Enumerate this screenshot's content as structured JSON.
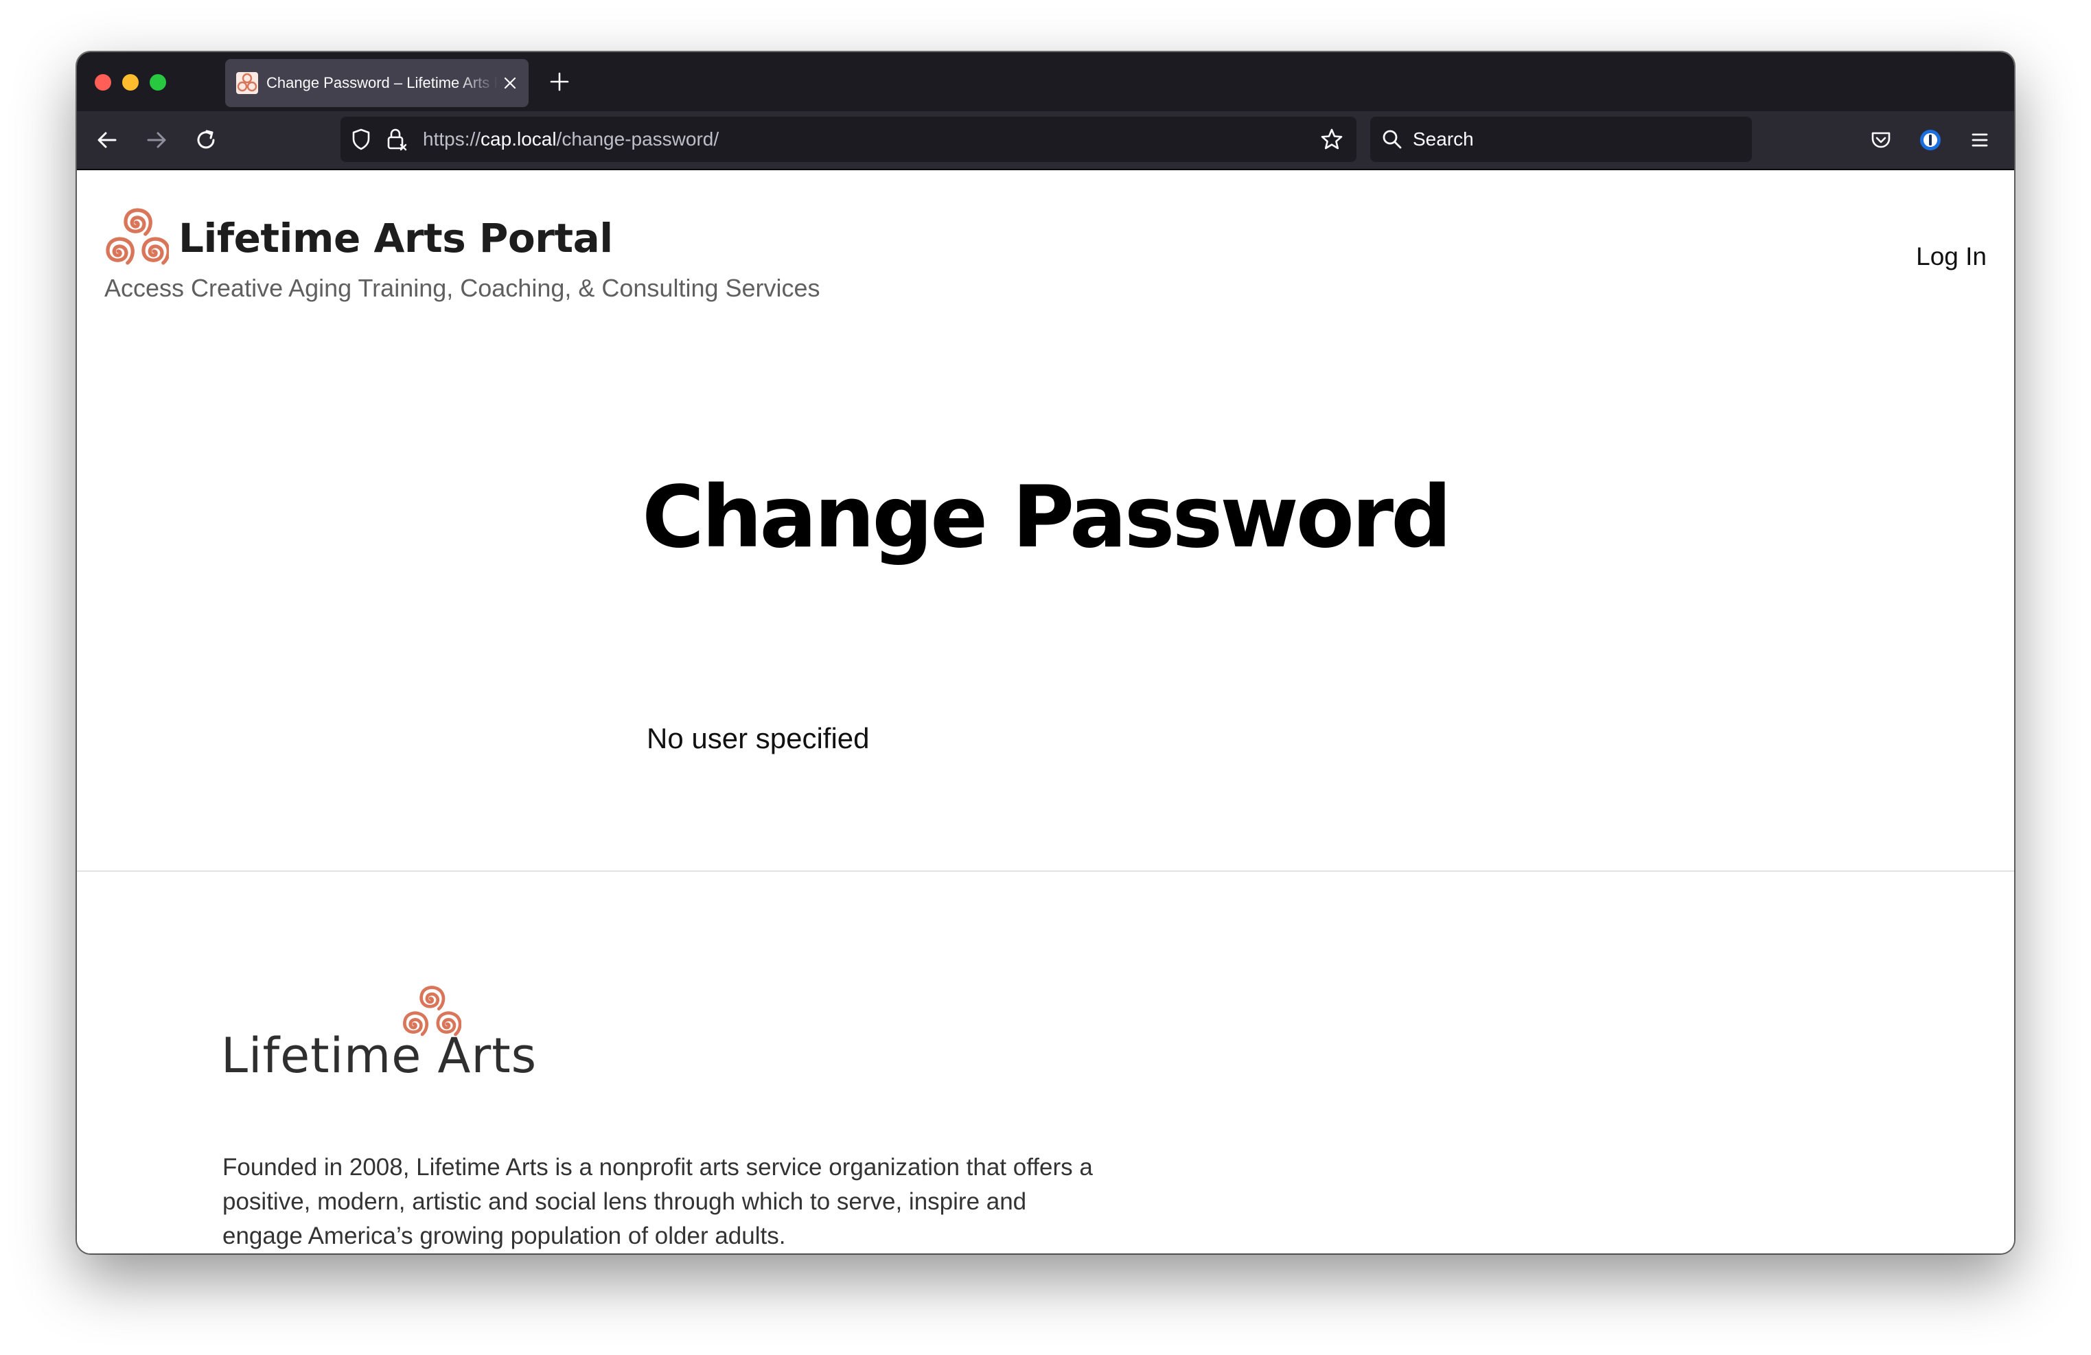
{
  "browser": {
    "tab": {
      "title": "Change Password – Lifetime Arts Portal"
    },
    "url": {
      "scheme": "https://",
      "host": "cap.local",
      "path": "/change-password/"
    },
    "search": {
      "placeholder": "Search"
    }
  },
  "header": {
    "site_name": "Lifetime Arts Portal",
    "tagline": "Access Creative Aging Training, Coaching, & Consulting Services",
    "login_label": "Log In"
  },
  "main": {
    "title": "Change Password",
    "message": "No user specified"
  },
  "footer": {
    "logo_text": "Lifetime Arts",
    "about": "Founded in 2008, Lifetime Arts is a nonprofit arts service organization that offers a positive, modern, artistic and social lens through which to serve, inspire and engage America’s growing population of older adults."
  },
  "colors": {
    "brand_accent": "#d9765a",
    "browser_dark": "#1c1b22",
    "toolbar": "#2b2a33"
  },
  "icons": {
    "logo": "triple-spiral-icon",
    "nav": [
      "back-arrow-icon",
      "forward-arrow-icon",
      "reload-icon"
    ],
    "url": [
      "shield-icon",
      "lock-icon",
      "star-icon"
    ],
    "toolbar": [
      "pocket-icon",
      "password-manager-icon",
      "hamburger-menu-icon"
    ]
  }
}
